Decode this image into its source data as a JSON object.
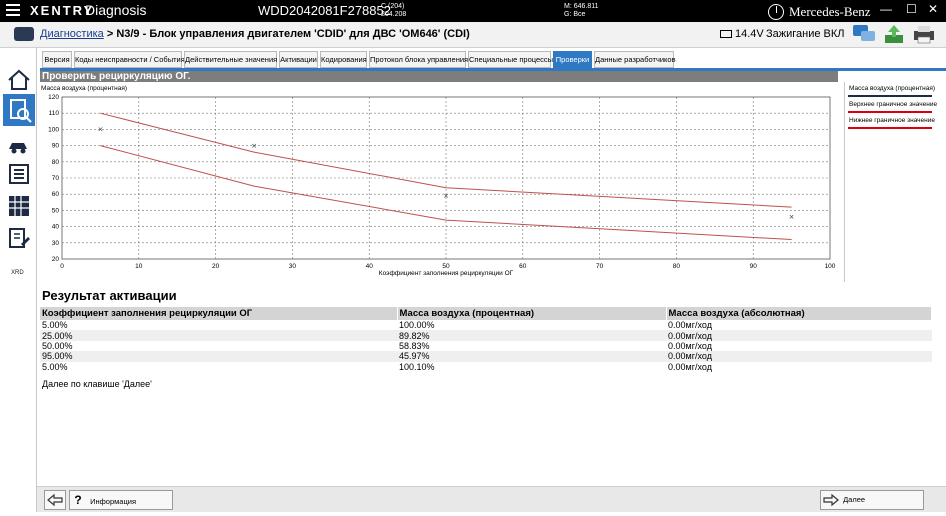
{
  "titlebar": {
    "brand": "XENTRY",
    "app": "Diagnosis",
    "vin": "WDD2042081F278852",
    "c_line1": "C (204)",
    "c_line2": "204.208",
    "m_line1": "M: 646.811",
    "m_line2": "G: Все",
    "mb": "Mercedes-Benz"
  },
  "navbar": {
    "crumb_link": "Диагностика",
    "crumb_rest": " > N3/9 - Блок управления двигателем 'CDID' для ДВС 'OM646' (CDI)",
    "voltage": "14.4V",
    "ignition": "Зажигание ВКЛ"
  },
  "tabs": [
    "Версия",
    "Коды неисправности / События",
    "Действительные значения",
    "Активации",
    "Кодирования",
    "Протокол блока управления",
    "Специальные процессы",
    "Проверки",
    "Данные разработчиков"
  ],
  "panel_title": "Проверить рециркуляцию ОГ.",
  "chart_data": {
    "type": "line",
    "ylabel": "Масса воздуха (процентная)",
    "xlabel": "Коэффициент заполнения рециркуляции ОГ",
    "xlim": [
      0,
      100
    ],
    "ylim": [
      20,
      120
    ],
    "xticks": [
      "0",
      "10",
      "20",
      "30",
      "40",
      "50",
      "60",
      "70",
      "80",
      "90",
      "100"
    ],
    "yticks": [
      "20",
      "30",
      "40",
      "50",
      "60",
      "70",
      "80",
      "90",
      "100",
      "110",
      "120"
    ],
    "grid": true,
    "legend": [
      "Масса воздуха (процентная)",
      "Верхнее граничное значение",
      "Нижнее граничное значение"
    ],
    "series": [
      {
        "name": "Масса воздуха (процентная)",
        "style": "points",
        "color": "#333333",
        "x": [
          5,
          25,
          50,
          95
        ],
        "y": [
          100.0,
          89.82,
          58.83,
          45.97
        ]
      },
      {
        "name": "Верхнее граничное значение",
        "style": "line",
        "color": "#c0504d",
        "x": [
          5,
          25,
          50,
          95
        ],
        "y": [
          110,
          86,
          64,
          52
        ]
      },
      {
        "name": "Нижнее граничное значение",
        "style": "line",
        "color": "#c0504d",
        "x": [
          5,
          25,
          50,
          95
        ],
        "y": [
          90,
          65,
          44,
          32
        ]
      }
    ]
  },
  "result": {
    "title": "Результат активации",
    "headers": [
      "Коэффициент заполнения рециркуляции ОГ",
      "Масса воздуха (процентная)",
      "Масса воздуха (абсолютная)"
    ],
    "rows": [
      [
        "5.00%",
        "100.00%",
        "0.00мг/ход"
      ],
      [
        "25.00%",
        "89.82%",
        "0.00мг/ход"
      ],
      [
        "50.00%",
        "58.83%",
        "0.00мг/ход"
      ],
      [
        "95.00%",
        "45.97%",
        "0.00мг/ход"
      ],
      [
        "5.00%",
        "100.10%",
        "0.00мг/ход"
      ]
    ],
    "note": "Далее по клавише 'Далее'"
  },
  "footer": {
    "info_label": "Информация",
    "next_label": "Далее"
  },
  "colors": {
    "accent": "#2f78c4",
    "limit_line": "#c0504d",
    "header_bar": "#7d7d7d"
  }
}
